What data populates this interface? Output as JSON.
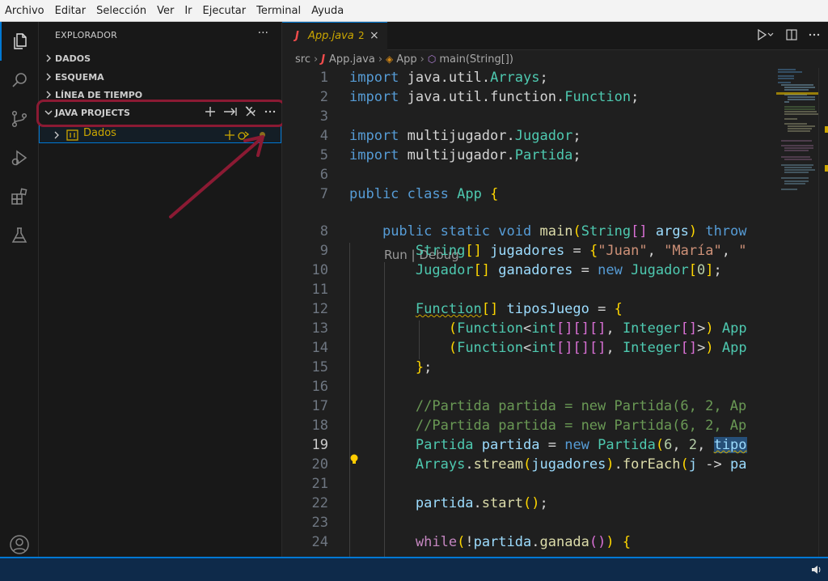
{
  "menu": [
    "Archivo",
    "Editar",
    "Selección",
    "Ver",
    "Ir",
    "Ejecutar",
    "Terminal",
    "Ayuda"
  ],
  "activity_bar": [
    "files-icon",
    "search-icon",
    "source-control-icon",
    "run-debug-icon",
    "extensions-icon",
    "testing-icon",
    "account-icon"
  ],
  "sidebar": {
    "title": "EXPLORADOR",
    "more": "···",
    "sections": [
      "DADOS",
      "ESQUEMA",
      "LÍNEA DE TIEMPO"
    ],
    "java_projects": {
      "title": "JAVA PROJECTS",
      "actions": [
        "add-icon",
        "export-jar-icon",
        "tools-icon",
        "more-icon"
      ],
      "project": "Dados"
    }
  },
  "editor": {
    "tab": {
      "icon": "J",
      "name": "App.java",
      "problems": "2",
      "close": "×"
    },
    "breadcrumb": [
      "src",
      "App.java",
      "App",
      "main(String[])"
    ],
    "codelens": "Run | Debug",
    "lines": [
      {
        "n": "1",
        "t": "import java.util.Arrays;"
      },
      {
        "n": "2",
        "t": "import java.util.function.Function;"
      },
      {
        "n": "3",
        "t": ""
      },
      {
        "n": "4",
        "t": "import multijugador.Jugador;"
      },
      {
        "n": "5",
        "t": "import multijugador.Partida;"
      },
      {
        "n": "6",
        "t": ""
      },
      {
        "n": "7",
        "t": "public class App {"
      },
      {
        "n": "8",
        "t": "    public static void main(String[] args) throw"
      },
      {
        "n": "9",
        "t": "        String[] jugadores = {\"Juan\", \"María\", \""
      },
      {
        "n": "10",
        "t": "        Jugador[] ganadores = new Jugador[0];"
      },
      {
        "n": "11",
        "t": ""
      },
      {
        "n": "12",
        "t": "        Function[] tiposJuego = {"
      },
      {
        "n": "13",
        "t": "            (Function<int[][][], Integer[]>) App"
      },
      {
        "n": "14",
        "t": "            (Function<int[][][], Integer[]>) App"
      },
      {
        "n": "15",
        "t": "        };"
      },
      {
        "n": "16",
        "t": ""
      },
      {
        "n": "17",
        "t": "        //Partida partida = new Partida(6, 2, Ap"
      },
      {
        "n": "18",
        "t": "        //Partida partida = new Partida(6, 2, Ap"
      },
      {
        "n": "19",
        "t": "        Partida partida = new Partida(6, 2, tipo"
      },
      {
        "n": "20",
        "t": "        Arrays.stream(jugadores).forEach(j -> pa"
      },
      {
        "n": "21",
        "t": ""
      },
      {
        "n": "22",
        "t": "        partida.start();"
      },
      {
        "n": "23",
        "t": ""
      },
      {
        "n": "24",
        "t": "        while(!partida.ganada()) {"
      }
    ],
    "current_line": "19"
  },
  "colors": {
    "accent": "#0078d4",
    "annotation": "#8b1a33",
    "warning": "#cca700"
  }
}
